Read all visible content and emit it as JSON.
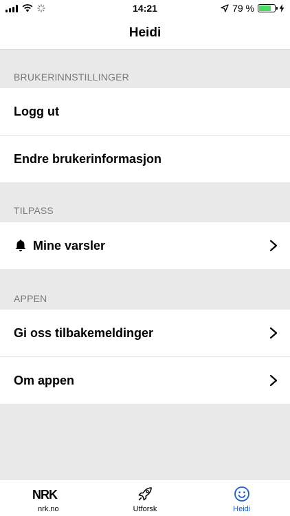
{
  "status_bar": {
    "time": "14:21",
    "battery_text": "79 %",
    "battery_level": 0.79,
    "icons": [
      "signal-icon",
      "wifi-icon",
      "loading-icon",
      "location-icon",
      "battery-icon",
      "charging-icon"
    ]
  },
  "nav": {
    "title": "Heidi"
  },
  "sections": {
    "user_settings": {
      "header": "BRUKERINNSTILLINGER",
      "items": [
        {
          "label": "Logg ut"
        },
        {
          "label": "Endre brukerinformasjon"
        }
      ]
    },
    "customize": {
      "header": "TILPASS",
      "items": [
        {
          "label": "Mine varsler",
          "icon": "bell-icon"
        }
      ]
    },
    "app": {
      "header": "APPEN",
      "items": [
        {
          "label": "Gi oss tilbakemeldinger"
        },
        {
          "label": "Om appen"
        }
      ]
    }
  },
  "tab_bar": {
    "tabs": [
      {
        "label": "nrk.no",
        "icon": "nrk-logo-icon",
        "logo_text": "NRK"
      },
      {
        "label": "Utforsk",
        "icon": "rocket-icon"
      },
      {
        "label": "Heidi",
        "icon": "smiley-icon",
        "active": true
      }
    ]
  },
  "colors": {
    "accent": "#1a5bd6",
    "battery": "#4cd964",
    "background": "#e9e9e9",
    "section_header": "#7a7a7a"
  }
}
